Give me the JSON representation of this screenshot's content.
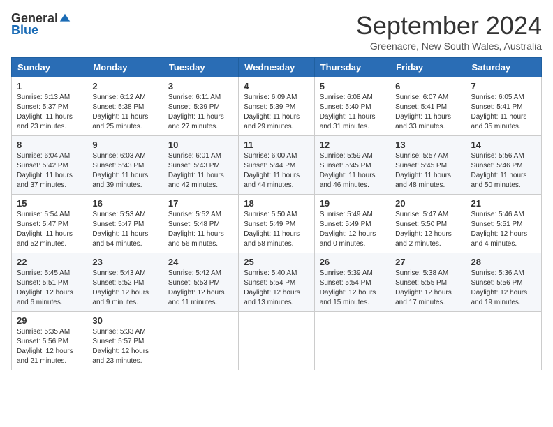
{
  "logo": {
    "general": "General",
    "blue": "Blue"
  },
  "header": {
    "title": "September 2024",
    "subtitle": "Greenacre, New South Wales, Australia"
  },
  "weekdays": [
    "Sunday",
    "Monday",
    "Tuesday",
    "Wednesday",
    "Thursday",
    "Friday",
    "Saturday"
  ],
  "weeks": [
    [
      {
        "day": "1",
        "sunrise": "6:13 AM",
        "sunset": "5:37 PM",
        "daylight": "11 hours and 23 minutes."
      },
      {
        "day": "2",
        "sunrise": "6:12 AM",
        "sunset": "5:38 PM",
        "daylight": "11 hours and 25 minutes."
      },
      {
        "day": "3",
        "sunrise": "6:11 AM",
        "sunset": "5:39 PM",
        "daylight": "11 hours and 27 minutes."
      },
      {
        "day": "4",
        "sunrise": "6:09 AM",
        "sunset": "5:39 PM",
        "daylight": "11 hours and 29 minutes."
      },
      {
        "day": "5",
        "sunrise": "6:08 AM",
        "sunset": "5:40 PM",
        "daylight": "11 hours and 31 minutes."
      },
      {
        "day": "6",
        "sunrise": "6:07 AM",
        "sunset": "5:41 PM",
        "daylight": "11 hours and 33 minutes."
      },
      {
        "day": "7",
        "sunrise": "6:05 AM",
        "sunset": "5:41 PM",
        "daylight": "11 hours and 35 minutes."
      }
    ],
    [
      {
        "day": "8",
        "sunrise": "6:04 AM",
        "sunset": "5:42 PM",
        "daylight": "11 hours and 37 minutes."
      },
      {
        "day": "9",
        "sunrise": "6:03 AM",
        "sunset": "5:43 PM",
        "daylight": "11 hours and 39 minutes."
      },
      {
        "day": "10",
        "sunrise": "6:01 AM",
        "sunset": "5:43 PM",
        "daylight": "11 hours and 42 minutes."
      },
      {
        "day": "11",
        "sunrise": "6:00 AM",
        "sunset": "5:44 PM",
        "daylight": "11 hours and 44 minutes."
      },
      {
        "day": "12",
        "sunrise": "5:59 AM",
        "sunset": "5:45 PM",
        "daylight": "11 hours and 46 minutes."
      },
      {
        "day": "13",
        "sunrise": "5:57 AM",
        "sunset": "5:45 PM",
        "daylight": "11 hours and 48 minutes."
      },
      {
        "day": "14",
        "sunrise": "5:56 AM",
        "sunset": "5:46 PM",
        "daylight": "11 hours and 50 minutes."
      }
    ],
    [
      {
        "day": "15",
        "sunrise": "5:54 AM",
        "sunset": "5:47 PM",
        "daylight": "11 hours and 52 minutes."
      },
      {
        "day": "16",
        "sunrise": "5:53 AM",
        "sunset": "5:47 PM",
        "daylight": "11 hours and 54 minutes."
      },
      {
        "day": "17",
        "sunrise": "5:52 AM",
        "sunset": "5:48 PM",
        "daylight": "11 hours and 56 minutes."
      },
      {
        "day": "18",
        "sunrise": "5:50 AM",
        "sunset": "5:49 PM",
        "daylight": "11 hours and 58 minutes."
      },
      {
        "day": "19",
        "sunrise": "5:49 AM",
        "sunset": "5:49 PM",
        "daylight": "12 hours and 0 minutes."
      },
      {
        "day": "20",
        "sunrise": "5:47 AM",
        "sunset": "5:50 PM",
        "daylight": "12 hours and 2 minutes."
      },
      {
        "day": "21",
        "sunrise": "5:46 AM",
        "sunset": "5:51 PM",
        "daylight": "12 hours and 4 minutes."
      }
    ],
    [
      {
        "day": "22",
        "sunrise": "5:45 AM",
        "sunset": "5:51 PM",
        "daylight": "12 hours and 6 minutes."
      },
      {
        "day": "23",
        "sunrise": "5:43 AM",
        "sunset": "5:52 PM",
        "daylight": "12 hours and 9 minutes."
      },
      {
        "day": "24",
        "sunrise": "5:42 AM",
        "sunset": "5:53 PM",
        "daylight": "12 hours and 11 minutes."
      },
      {
        "day": "25",
        "sunrise": "5:40 AM",
        "sunset": "5:54 PM",
        "daylight": "12 hours and 13 minutes."
      },
      {
        "day": "26",
        "sunrise": "5:39 AM",
        "sunset": "5:54 PM",
        "daylight": "12 hours and 15 minutes."
      },
      {
        "day": "27",
        "sunrise": "5:38 AM",
        "sunset": "5:55 PM",
        "daylight": "12 hours and 17 minutes."
      },
      {
        "day": "28",
        "sunrise": "5:36 AM",
        "sunset": "5:56 PM",
        "daylight": "12 hours and 19 minutes."
      }
    ],
    [
      {
        "day": "29",
        "sunrise": "5:35 AM",
        "sunset": "5:56 PM",
        "daylight": "12 hours and 21 minutes."
      },
      {
        "day": "30",
        "sunrise": "5:33 AM",
        "sunset": "5:57 PM",
        "daylight": "12 hours and 23 minutes."
      },
      null,
      null,
      null,
      null,
      null
    ]
  ]
}
